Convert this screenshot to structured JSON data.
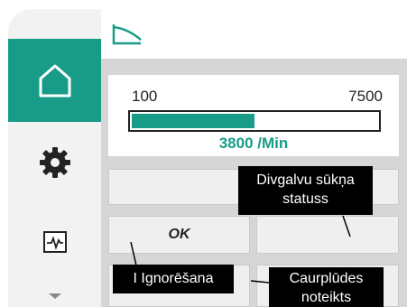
{
  "sidebar": {
    "items": [
      {
        "icon": "home-icon",
        "active": true
      },
      {
        "icon": "gear-icon",
        "active": false
      },
      {
        "icon": "pulse-monitor-icon",
        "active": false
      },
      {
        "icon": "chevron-down-icon",
        "active": false
      }
    ]
  },
  "header": {
    "icon": "curve-chart-icon"
  },
  "speed": {
    "range_min": "100",
    "range_max": "7500",
    "value_text": "3800 /Min",
    "fill_fraction": 0.5
  },
  "buttons": {
    "ok_label": "OK"
  },
  "tooltips": {
    "dual_pump_line1": "Divgalvu sūkņa",
    "dual_pump_line2": "statuss",
    "ignore": "I Ignorēšana",
    "flow_line1": "Caurplūdes",
    "flow_line2": "noteikts"
  },
  "colors": {
    "accent": "#189c87",
    "sidebar_bg": "#f2f2f2",
    "panel_bg": "#d6d6d6"
  }
}
